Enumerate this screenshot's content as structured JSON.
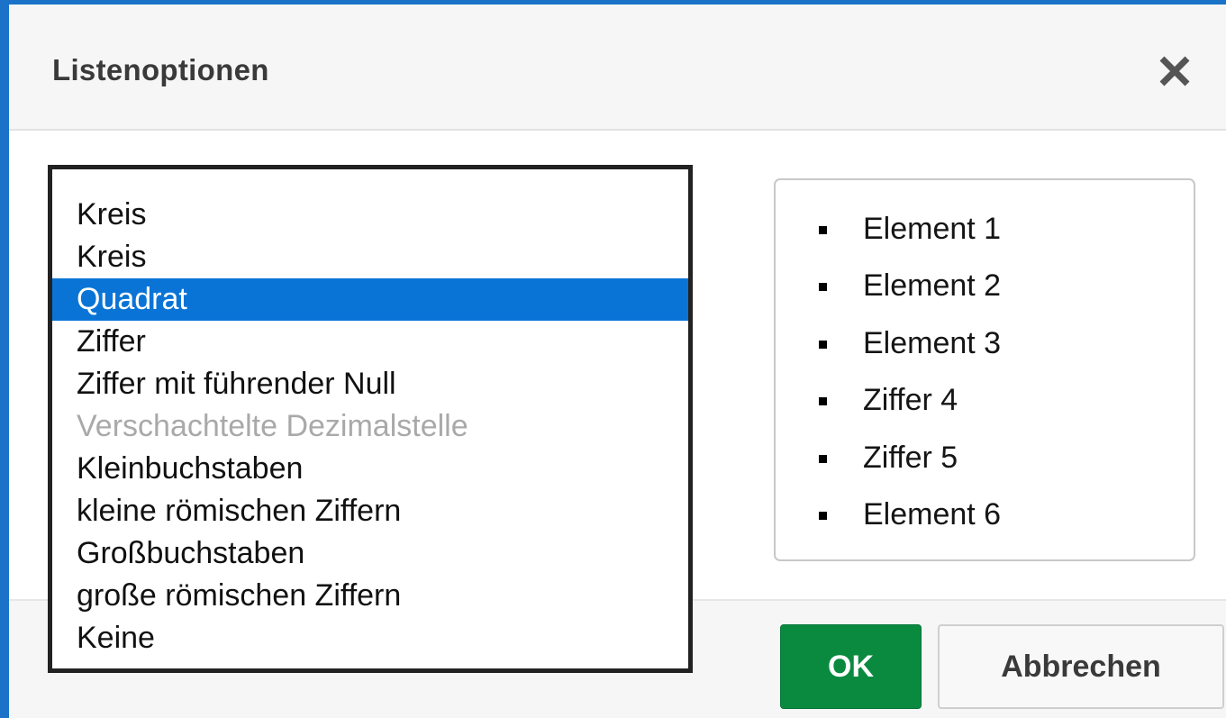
{
  "dialog": {
    "title": "Listenoptionen",
    "close_icon": "close-icon"
  },
  "list_style": {
    "options": [
      {
        "label": "Kreis",
        "state": "normal"
      },
      {
        "label": "Kreis",
        "state": "normal"
      },
      {
        "label": "Quadrat",
        "state": "selected"
      },
      {
        "label": "Ziffer",
        "state": "normal"
      },
      {
        "label": "Ziffer mit führender Null",
        "state": "normal"
      },
      {
        "label": "Verschachtelte Dezimalstelle",
        "state": "disabled"
      },
      {
        "label": "Kleinbuchstaben",
        "state": "normal"
      },
      {
        "label": "kleine römischen Ziffern",
        "state": "normal"
      },
      {
        "label": "Großbuchstaben",
        "state": "normal"
      },
      {
        "label": "große römischen Ziffern",
        "state": "normal"
      },
      {
        "label": "Keine",
        "state": "normal"
      }
    ],
    "selected_value": "Quadrat"
  },
  "preview": {
    "bullet_icon": "square-bullet-icon",
    "items": [
      "Element 1",
      "Element 2",
      "Element 3",
      "Ziffer 4",
      "Ziffer 5",
      "Element 6"
    ]
  },
  "buttons": {
    "ok_label": "OK",
    "cancel_label": "Abbrechen"
  },
  "colors": {
    "window_border": "#1a73c8",
    "selection": "#0a74d6",
    "ok_button": "#0a8a3f",
    "disabled_text": "#a9a9a9"
  }
}
